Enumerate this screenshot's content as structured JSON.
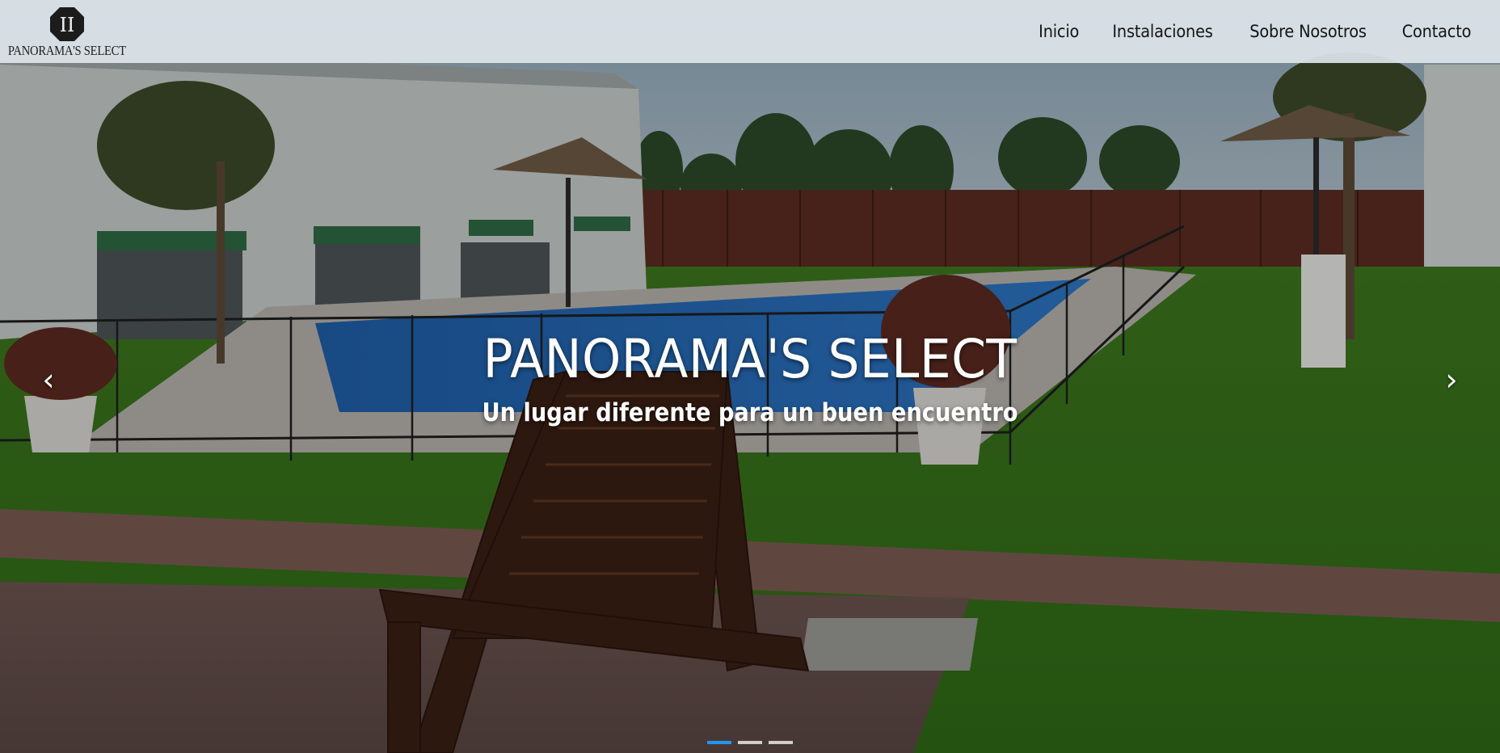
{
  "brand": {
    "logo_text": "PANORAMA'S SELECT",
    "logo_icon": "octagon-monogram-icon"
  },
  "nav": {
    "items": [
      {
        "label": "Inicio"
      },
      {
        "label": "Instalaciones"
      },
      {
        "label": "Sobre Nosotros"
      },
      {
        "label": "Contacto"
      }
    ]
  },
  "hero": {
    "title": "PANORAMA'S SELECT",
    "subtitle": "Un lugar diferente para un buen encuentro",
    "prev_icon": "‹",
    "next_icon": "›",
    "slides_count": 3,
    "active_slide": 1
  },
  "colors": {
    "navbar_bg": "#dee4ea",
    "nav_text": "#141414",
    "indicator_active": "#2196f3",
    "indicator_inactive": "#ffffff"
  }
}
